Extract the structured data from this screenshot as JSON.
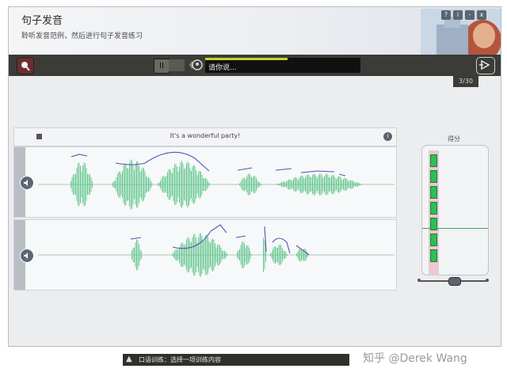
{
  "window": {
    "title": "句子发音",
    "subtitle": "聆听发音范例，然后进行句子发音练习",
    "buttons": [
      "?",
      "i",
      "-",
      "x"
    ]
  },
  "toolbar": {
    "pause_symbol": "II",
    "prompt": "请你说...",
    "prompt_progress": 0.53
  },
  "counter": "3/30",
  "sentence": "It's a wonderful party!",
  "score": {
    "label": "得分",
    "filled_segments": 7
  },
  "status": {
    "text": "口语训练：选择一项训练内容"
  },
  "watermark": "知乎 @Derek Wang",
  "colors": {
    "waveform": "#5cc58a",
    "pitch": "#5a4fb8",
    "toolbar": "#3b3c37",
    "meter_green": "#2fbe55",
    "prompt_bar": "#c8d42a"
  },
  "icons": {
    "record": "record-button-icon",
    "speaker": "speaker-icon",
    "next": "next-arrow-icon",
    "head": "head-profile-icon",
    "info": "info-icon",
    "status": "person-icon"
  }
}
